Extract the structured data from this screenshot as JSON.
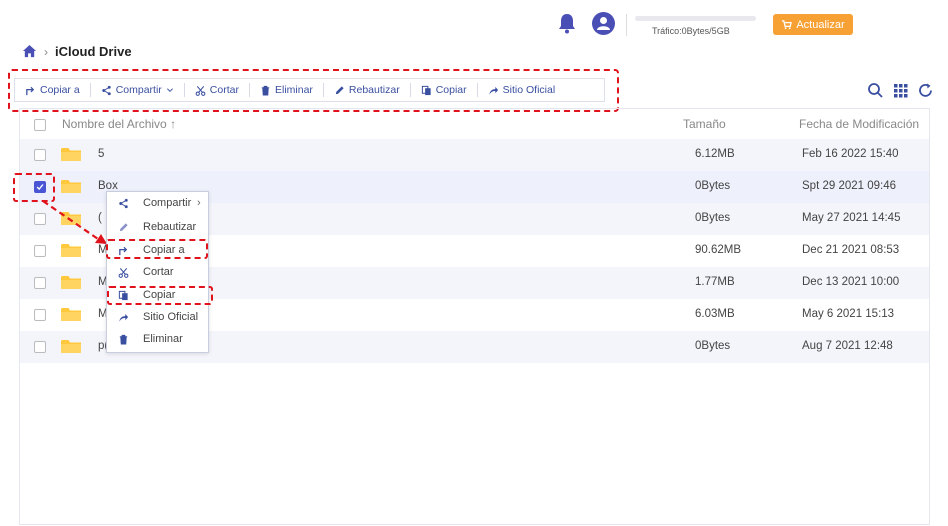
{
  "header": {
    "traffic_text": "Tráfico:0Bytes/5GB",
    "traffic_fraction": 0,
    "upgrade_label": "Actualizar",
    "icons": [
      "bell-icon",
      "user-avatar-icon",
      "cart-icon"
    ]
  },
  "breadcrumb": {
    "title": "iCloud Drive",
    "icons": [
      "home-icon",
      "chevron-right-icon"
    ]
  },
  "toolbar": {
    "copy_to": "Copiar a",
    "share": "Compartir",
    "cut": "Cortar",
    "delete": "Eliminar",
    "rename": "Rebautizar",
    "copy": "Copiar",
    "official_site": "Sitio Oficial"
  },
  "right_tools": [
    "search-icon",
    "grid-icon",
    "refresh-icon"
  ],
  "table": {
    "headers": {
      "name": "Nombre del Archivo",
      "sort": "↑",
      "size": "Tamaño",
      "date": "Fecha de Modificación"
    },
    "rows": [
      {
        "name": "5",
        "size": "6.12MB",
        "date": "Feb 16 2022 15:40",
        "checked": false
      },
      {
        "name": "Box",
        "size": "0Bytes",
        "date": "Spt 29 2021 09:46",
        "checked": true
      },
      {
        "name": "(",
        "size": "0Bytes",
        "date": "May 27 2021 14:45",
        "checked": false
      },
      {
        "name": "M",
        "size": "90.62MB",
        "date": "Dec 21 2021 08:53",
        "checked": false
      },
      {
        "name": "M",
        "size": "1.77MB",
        "date": "Dec 13 2021 10:00",
        "checked": false
      },
      {
        "name": "M",
        "size": "6.03MB",
        "date": "May 6 2021 15:13",
        "checked": false
      },
      {
        "name": "p(",
        "size": "0Bytes",
        "date": "Aug 7 2021 12:48",
        "checked": false
      }
    ]
  },
  "context_menu": {
    "items": [
      {
        "label": "Compartir",
        "icon": "share-icon",
        "submenu": "›"
      },
      {
        "label": "Rebautizar",
        "icon": "pencil-icon"
      },
      {
        "label": "Copiar a",
        "icon": "copy-to-icon"
      },
      {
        "label": "Cortar",
        "icon": "scissors-icon"
      },
      {
        "label": "Copiar",
        "icon": "copy-icon"
      },
      {
        "label": "Sitio Oficial",
        "icon": "external-share-icon"
      },
      {
        "label": "Eliminar",
        "icon": "trash-icon"
      }
    ]
  },
  "colors": {
    "accent": "#3a4fa0",
    "upgrade": "#f7a135",
    "highlight": "#e0121b",
    "folder": "#ffc83d"
  }
}
